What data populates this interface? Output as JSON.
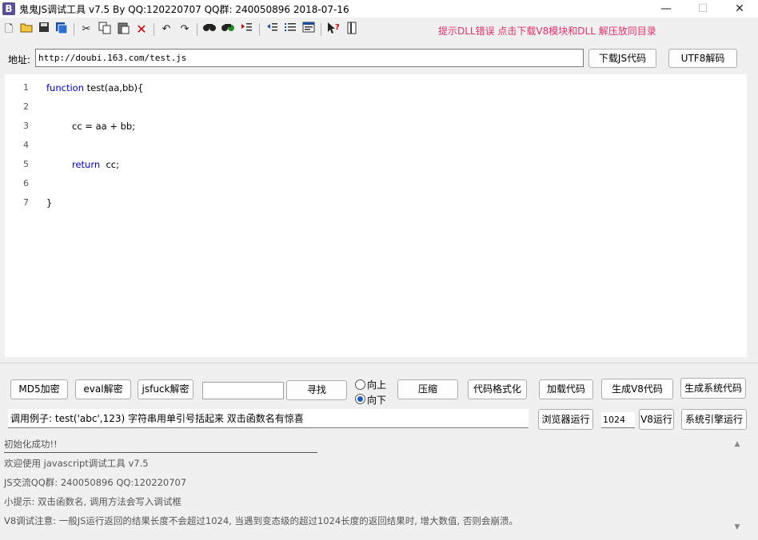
{
  "window": {
    "title": "鬼鬼JS调试工具 v7.5 By QQ:120220707  QQ群: 240050896  2018-07-16",
    "icon_letter": "B",
    "minimize": "—",
    "maximize": "☐",
    "close": "✕"
  },
  "toolbar": {
    "icons": [
      "new-file-icon",
      "open-folder-icon",
      "save-icon",
      "save-all-icon",
      "cut-icon",
      "copy-icon",
      "paste-icon",
      "delete-icon",
      "undo-icon",
      "redo-icon",
      "find-icon",
      "replace-icon",
      "indent-icon",
      "outdent-icon",
      "list-icon",
      "format-icon",
      "help-cursor-icon",
      "bookmark-icon"
    ],
    "hint": "提示DLL错误 点击下载V8模块和DLL 解压放同目录"
  },
  "address": {
    "label": "地址:",
    "value": "http://doubi.163.com/test.js",
    "download_button": "下载JS代码",
    "utf8_button": "UTF8解码"
  },
  "editor": {
    "line_numbers": [
      "1",
      "2",
      "3",
      "4",
      "5",
      "6",
      "7"
    ]
  },
  "buttons": {
    "md5": "MD5加密",
    "eval": "eval解密",
    "jsfuck": "jsfuck解密",
    "find": "寻找",
    "up": "向上",
    "down": "向下",
    "compress": "压缩",
    "format": "代码格式化",
    "load": "加载代码",
    "gen_v8": "生成V8代码",
    "gen_sys": "生成系统代码",
    "browser_run": "浏览器运行",
    "v8_run": "V8运行",
    "sys_run": "系统引擎运行"
  },
  "search_value": "",
  "direction_selected": "向下",
  "call_example": "调用例子: test('abc',123) 字符串用单引号括起来 双击函数名有惊喜",
  "length_value": "1024",
  "log": [
    "初始化成功!!",
    "欢迎使用 javascript调试工具 v7.5",
    "JS交流QQ群: 240050896  QQ:120220707",
    "小提示: 双击函数名, 调用方法会写入调试框",
    "V8调试注意: 一般JS运行返回的结果长度不会超过1024, 当遇到变态级的超过1024长度的返回结果时, 增大数值, 否则会崩溃。"
  ]
}
